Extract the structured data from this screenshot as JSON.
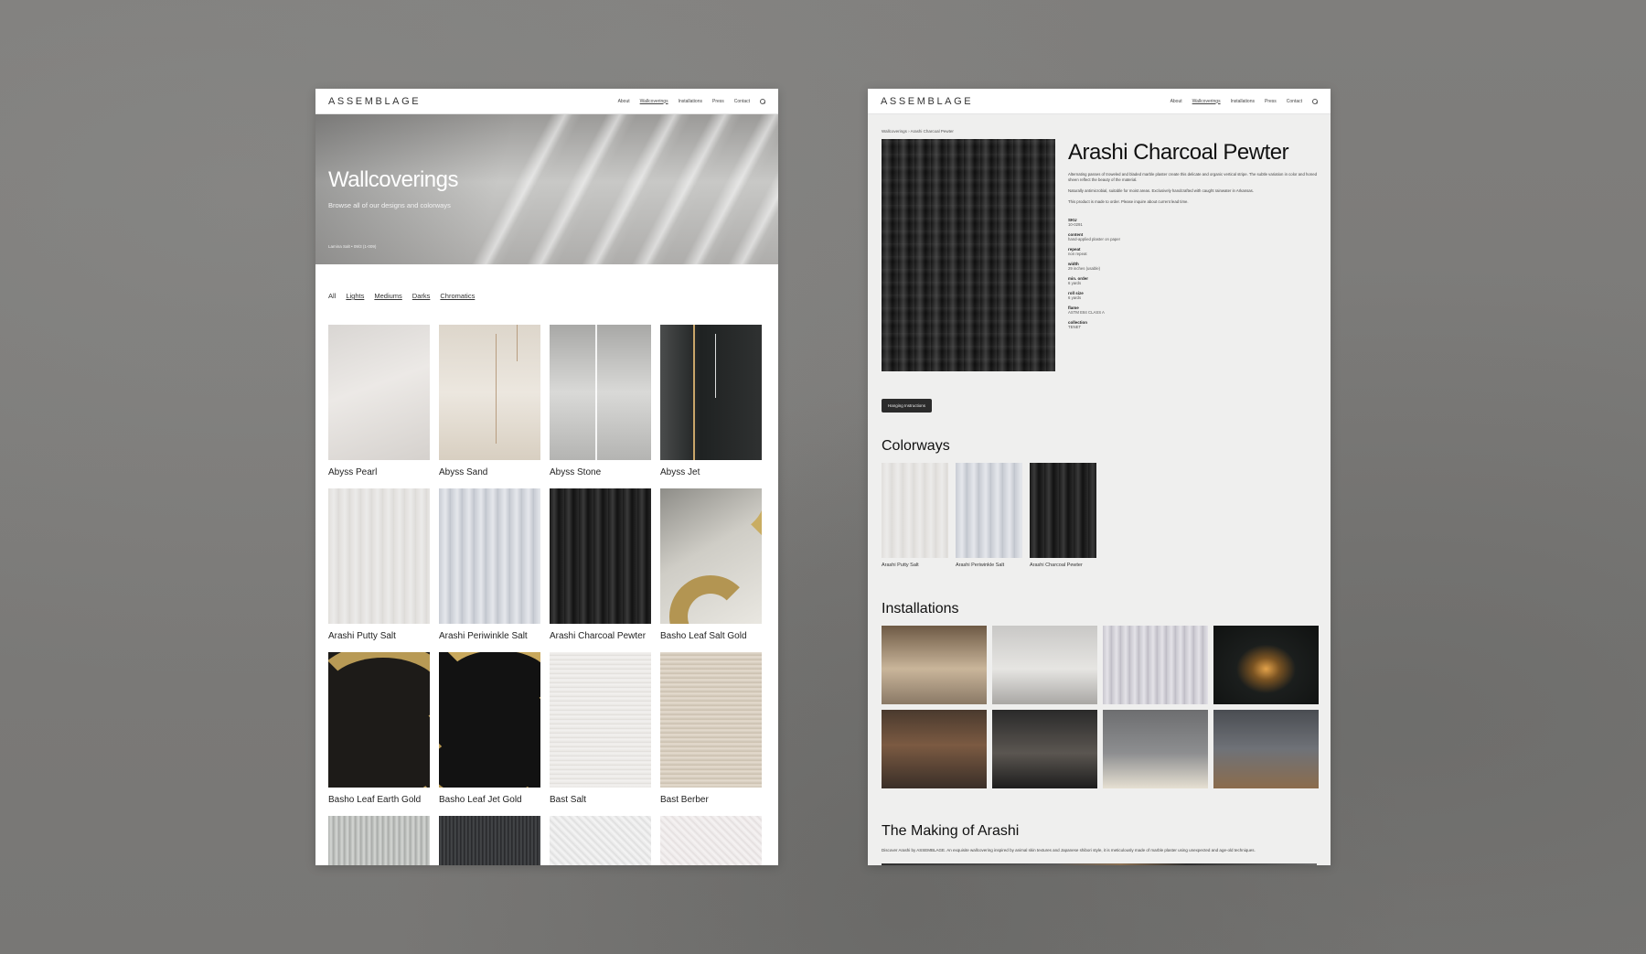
{
  "left": {
    "logo": "ASSEMBLAGE",
    "nav": [
      "About",
      "Wallcoverings",
      "Installations",
      "Press",
      "Contact"
    ],
    "hero": {
      "title": "Wallcoverings",
      "subtitle": "Browse all of our designs and colorways",
      "caption": "Lamina Salt • 09/3 (1-009)"
    },
    "filters": [
      "All",
      "Lights",
      "Mediums",
      "Darks",
      "Chromatics"
    ],
    "products": [
      {
        "name": "Abyss Pearl"
      },
      {
        "name": "Abyss Sand"
      },
      {
        "name": "Abyss Stone"
      },
      {
        "name": "Abyss Jet"
      },
      {
        "name": "Arashi Putty Salt"
      },
      {
        "name": "Arashi Periwinkle Salt"
      },
      {
        "name": "Arashi Charcoal Pewter"
      },
      {
        "name": "Basho Leaf Salt Gold"
      },
      {
        "name": "Basho Leaf Earth Gold"
      },
      {
        "name": "Basho Leaf Jet Gold"
      },
      {
        "name": "Bast Salt"
      },
      {
        "name": "Bast Berber"
      }
    ]
  },
  "right": {
    "logo": "ASSEMBLAGE",
    "nav": [
      "About",
      "Wallcoverings",
      "Installations",
      "Press",
      "Contact"
    ],
    "breadcrumb": "Wallcoverings › Arashi Charcoal Pewter",
    "product": {
      "title": "Arashi Charcoal Pewter",
      "desc1": "Alternating passes of troweled and bladed marble plaster create this delicate and organic vertical stripe. The subtle variation in color and honed sheen reflect the beauty of the material.",
      "desc2": "Naturally antimicrobial, suitable for moist areas. Exclusively handcrafted with caught rainwater in Arkansas.",
      "desc3": "This product is made to order. Please inquire about current lead time."
    },
    "specs": [
      {
        "label": "SKU",
        "value": "10-0291"
      },
      {
        "label": "content",
        "value": "hand-applied plaster on paper"
      },
      {
        "label": "repeat",
        "value": "non repeat"
      },
      {
        "label": "width",
        "value": "29 inches (usable)"
      },
      {
        "label": "min. order",
        "value": "6 yards"
      },
      {
        "label": "roll size",
        "value": "6 yards"
      },
      {
        "label": "flame",
        "value": "ASTM E84 CLASS A"
      },
      {
        "label": "collection",
        "value": "TENET"
      }
    ],
    "hanging_button": "Hanging Instructions",
    "colorways_title": "Colorways",
    "colorways": [
      {
        "name": "Arashi Putty Salt"
      },
      {
        "name": "Arashi Periwinkle Salt"
      },
      {
        "name": "Arashi Charcoal Pewter"
      }
    ],
    "installations_title": "Installations",
    "making_title": "The Making of Arashi",
    "making_desc": "Discover Arashi by ASSEMBLAGE. An exquisite wallcovering inspired by animal skin textures and Japanese shibori style, it is meticulously made of marble plaster using unexpected and age-old techniques."
  }
}
